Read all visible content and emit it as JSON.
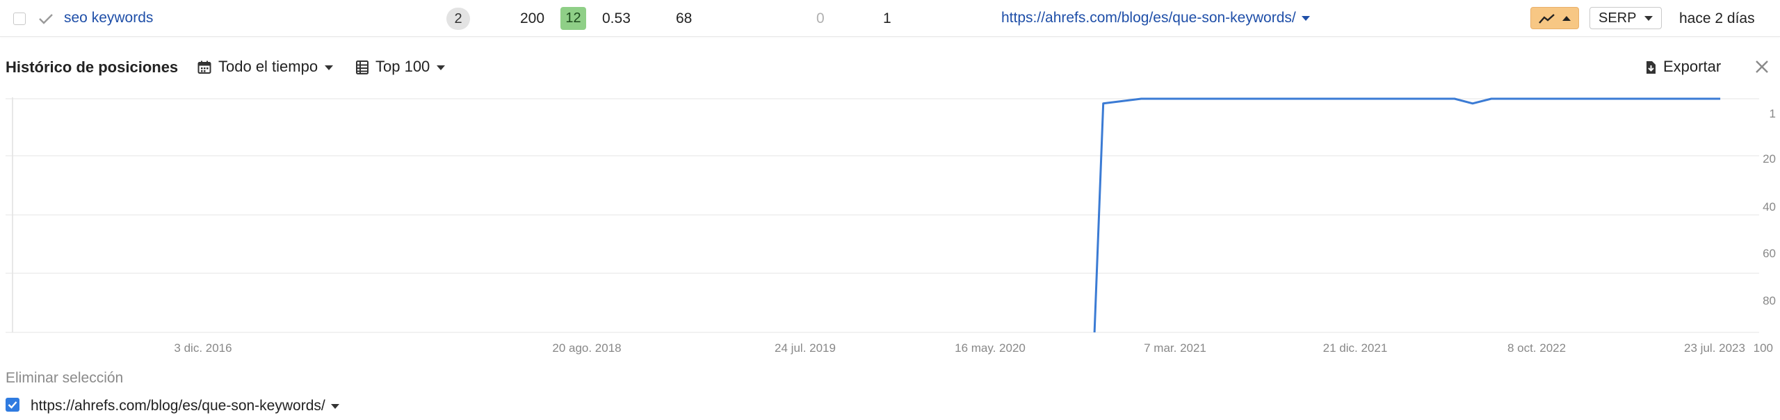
{
  "row": {
    "keyword": "seo keywords",
    "kd": "2",
    "volume": "200",
    "badge": "12",
    "cpc": "0.53",
    "traffic": "68",
    "paid": "0",
    "position": "1",
    "url": "https://ahrefs.com/blog/es/que-son-keywords/",
    "serp_label": "SERP",
    "updated": "hace 2 días"
  },
  "panel": {
    "title": "Histórico de posiciones",
    "range_label": "Todo el tiempo",
    "top_label": "Top 100",
    "export_label": "Exportar"
  },
  "legend": {
    "clear_label": "Eliminar selección",
    "series_url": "https://ahrefs.com/blog/es/que-son-keywords/"
  },
  "colors": {
    "accent_link": "#1f4fa8",
    "series": "#3b7bd4",
    "trend_badge": "#f7c784",
    "green_badge": "#8fcf87"
  },
  "chart_data": {
    "type": "line",
    "y_axis_inverted": true,
    "ylim": [
      1,
      100
    ],
    "y_ticks": [
      "1",
      "20",
      "40",
      "60",
      "80",
      "100"
    ],
    "x_tick_labels": [
      "3 dic. 2016",
      "20 ago. 2018",
      "24 jul. 2019",
      "16 may. 2020",
      "7 mar. 2021",
      "21 dic. 2021",
      "8 oct. 2022",
      "23 jul. 2023"
    ],
    "grid": true,
    "series": [
      {
        "points": [
          {
            "x": "2020-11-01",
            "y": 100
          },
          {
            "x": "2020-11-15",
            "y": 3
          },
          {
            "x": "2021-01-15",
            "y": 1
          },
          {
            "x": "2022-06-01",
            "y": 1
          },
          {
            "x": "2022-06-30",
            "y": 3
          },
          {
            "x": "2022-07-30",
            "y": 1
          },
          {
            "x": "2023-08-01",
            "y": 1
          }
        ]
      }
    ]
  }
}
